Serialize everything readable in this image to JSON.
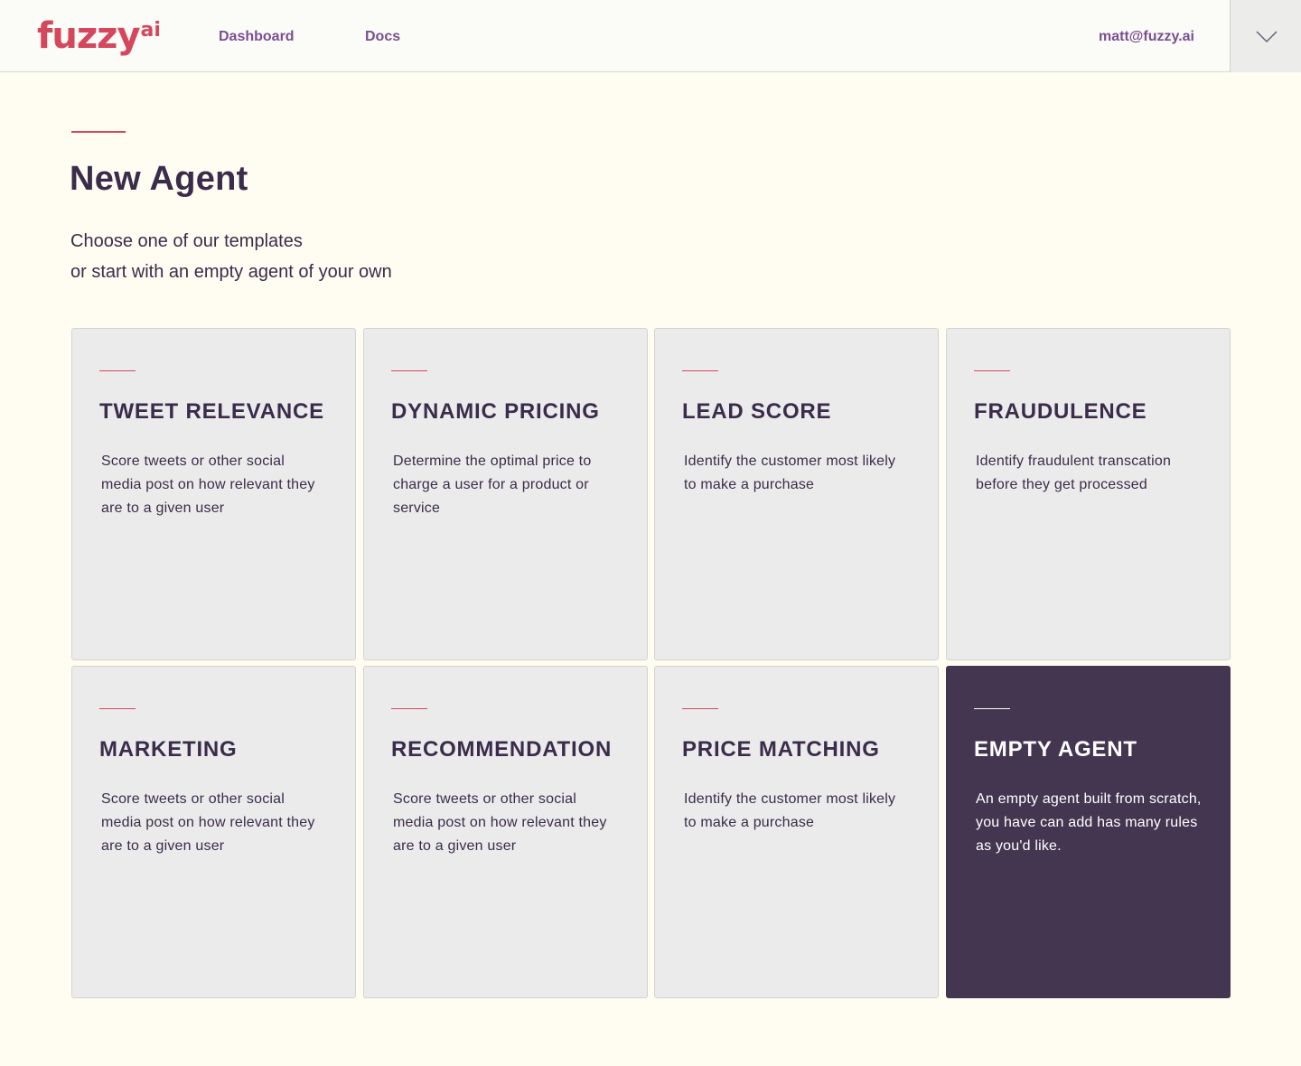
{
  "header": {
    "logo": "fuzzy",
    "logo_sup": "ai",
    "nav": {
      "dashboard": "Dashboard",
      "docs": "Docs"
    },
    "user_email": "matt@fuzzy.ai",
    "menu_icon": "chevron-down-icon"
  },
  "page": {
    "title": "New Agent",
    "subtitle_line1": "Choose one of our  templates",
    "subtitle_line2": "or start with an empty agent of your own"
  },
  "templates": [
    {
      "title": "TWEET RELEVANCE",
      "description": "Score tweets or other social media post on how relevant they are to a given user"
    },
    {
      "title": "DYNAMIC PRICING",
      "description": "Determine the optimal price to charge a user for a product or service"
    },
    {
      "title": "LEAD SCORE",
      "description": "Identify the customer most likely to make a purchase"
    },
    {
      "title": "FRAUDULENCE",
      "description": "Identify fraudulent transcation before they get processed"
    },
    {
      "title": "MARKETING",
      "description": "Score tweets or other social media post on how relevant they are to a given user"
    },
    {
      "title": "RECOMMENDATION",
      "description": "Score tweets or other social media post on how relevant they are to a given user"
    },
    {
      "title": "PRICE MATCHING",
      "description": "Identify the customer most likely to make a purchase"
    },
    {
      "title": "EMPTY AGENT",
      "description": "An empty agent built from scratch, you have can add has many rules as you'd like."
    }
  ],
  "colors": {
    "background": "#fffdf2",
    "brand": "#d4475c",
    "nav_link": "#7a4f94",
    "text": "#3a2c4a",
    "card": "#ebebeb",
    "card_dark": "#443651"
  }
}
